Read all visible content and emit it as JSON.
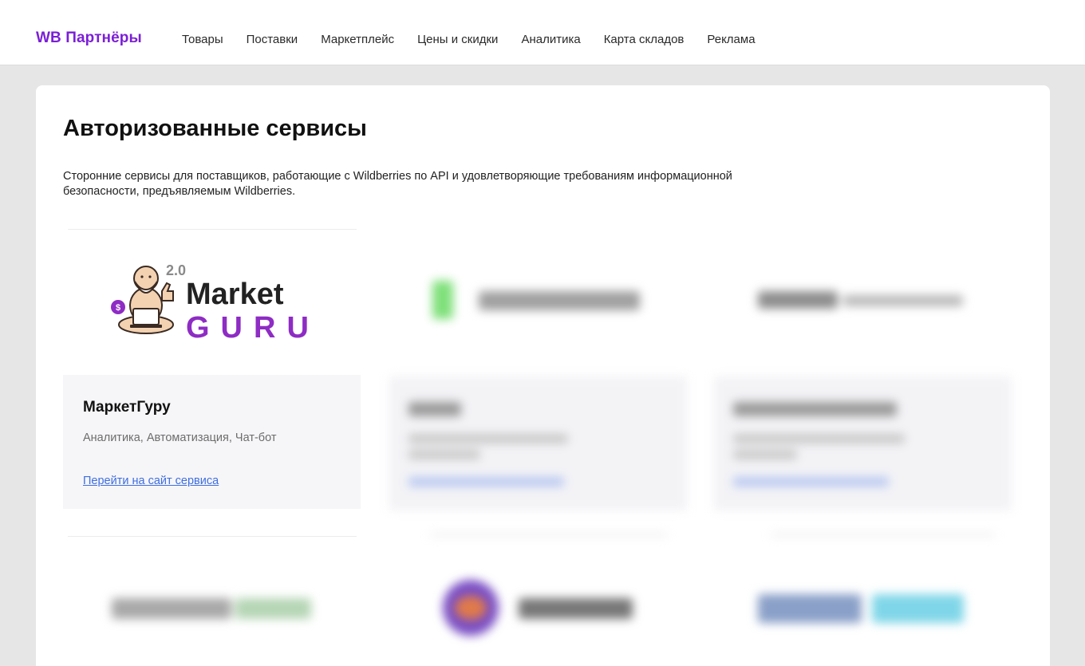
{
  "header": {
    "brand": "WB Партнёры",
    "nav": [
      "Товары",
      "Поставки",
      "Маркетплейс",
      "Цены и скидки",
      "Аналитика",
      "Карта складов",
      "Реклама"
    ]
  },
  "page": {
    "title": "Авторизованные сервисы",
    "description": "Сторонние сервисы для поставщиков, работающие с Wildberries по API и удовлетворяющие требованиям информационной безопасности, предъявляемым Wildberries."
  },
  "services": [
    {
      "logo": {
        "version": "2.0",
        "word1": "Market",
        "word2": "GURU",
        "coin_symbol": "$"
      },
      "name": "МаркетГуру",
      "tags": "Аналитика, Автоматизация, Чат-бот",
      "link_label": "Перейти на сайт сервиса"
    }
  ],
  "colors": {
    "brand": "#7b1fd6",
    "link": "#3f6ee0",
    "guru_purple": "#8e2cc4",
    "card_bg": "#f6f6f9",
    "page_bg": "#e6e6e6"
  }
}
